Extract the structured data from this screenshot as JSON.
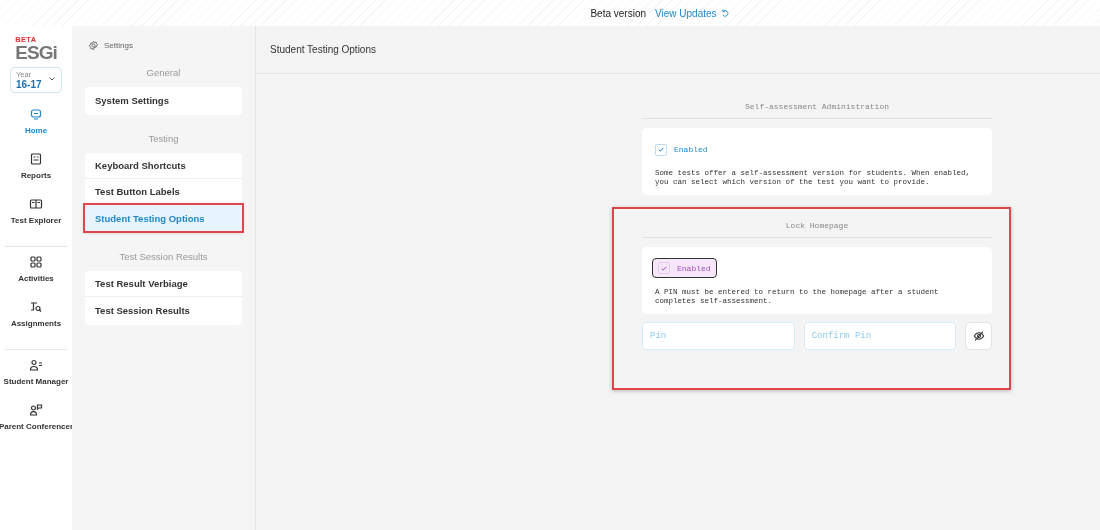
{
  "top_bar": {
    "version_label": "Beta version",
    "updates_link": "View Updates"
  },
  "logo": {
    "badge": "BETA",
    "wordmark": "ESGi"
  },
  "year_selector": {
    "label": "Year",
    "value": "16-17"
  },
  "nav": {
    "groups": [
      [
        {
          "label": "Home",
          "selected": true
        },
        {
          "label": "Reports",
          "selected": false
        },
        {
          "label": "Test Explorer",
          "selected": false
        }
      ],
      [
        {
          "label": "Activities",
          "selected": false
        },
        {
          "label": "Assignments",
          "selected": false
        }
      ],
      [
        {
          "label": "Student Manager",
          "selected": false
        },
        {
          "label": "Parent Conferencer",
          "selected": false
        }
      ]
    ]
  },
  "settings_panel": {
    "title": "Settings",
    "groups": [
      {
        "title": "General",
        "items": [
          {
            "label": "System Settings",
            "selected": false,
            "highlighted": false
          }
        ]
      },
      {
        "title": "Testing",
        "items": [
          {
            "label": "Keyboard Shortcuts",
            "selected": false,
            "highlighted": false
          },
          {
            "label": "Test Button Labels",
            "selected": false,
            "highlighted": false
          },
          {
            "label": "Student Testing Options",
            "selected": true,
            "highlighted": true
          }
        ]
      },
      {
        "title": "Test Session Results",
        "items": [
          {
            "label": "Test Result Verbiage",
            "selected": false,
            "highlighted": false
          },
          {
            "label": "Test Session Results",
            "selected": false,
            "highlighted": false
          }
        ]
      }
    ]
  },
  "page_title": "Student Testing Options",
  "sections": [
    {
      "title": "Self-assessment Administration",
      "highlighted": false,
      "checkbox": {
        "label": "Enabled",
        "checked": true,
        "focused": false
      },
      "description": "Some tests offer a self-assessment version for students. When enabled, you can select which version of the test you want to provide."
    },
    {
      "title": "Lock Homepage",
      "highlighted": true,
      "checkbox": {
        "label": "Enabled",
        "checked": true,
        "focused": true
      },
      "description": "A PIN must be entered to return to the homepage after a student completes self-assessment.",
      "fields": [
        {
          "placeholder": "Pin"
        },
        {
          "placeholder": "Confirm Pin"
        }
      ],
      "visibility_toggle": true
    }
  ]
}
